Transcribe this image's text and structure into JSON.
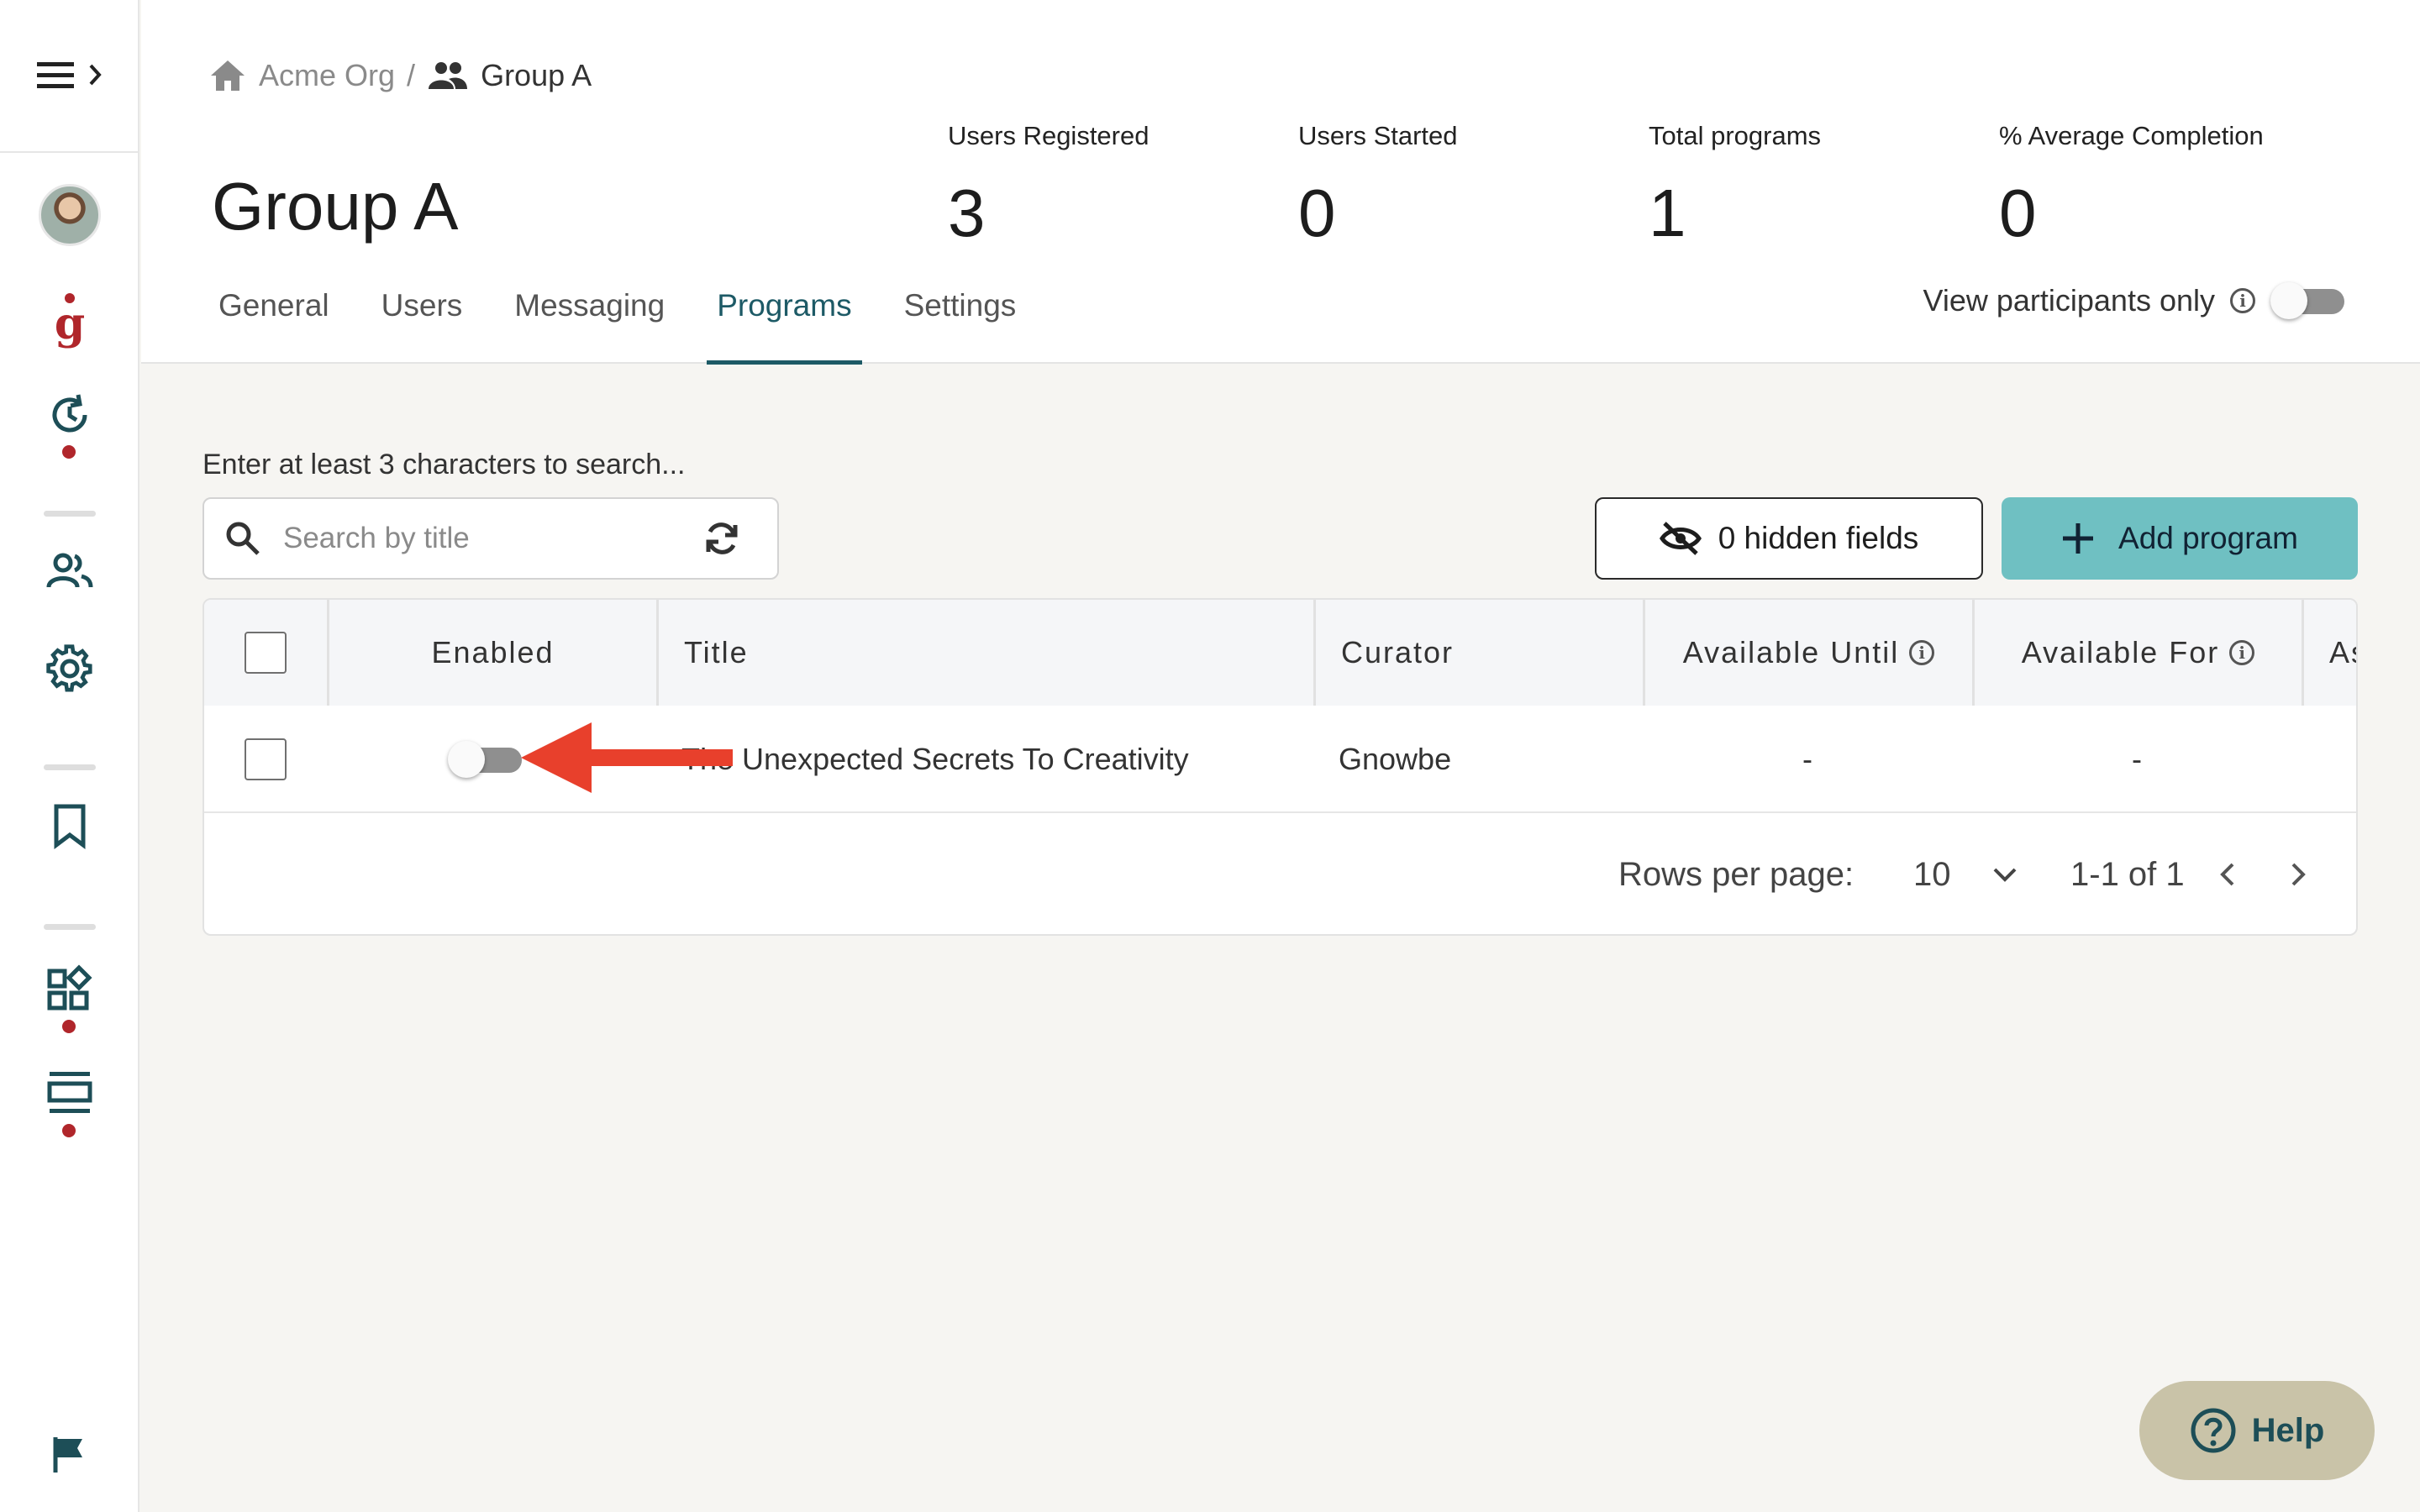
{
  "sidebar": {
    "icons": [
      "menu-expand-icon",
      "avatar",
      "brand-g-icon",
      "history-icon",
      "users-icon",
      "settings-icon",
      "bookmark-icon",
      "widgets-icon",
      "layout-icon",
      "flag-icon"
    ],
    "accent_color": "#b0262b",
    "icon_color": "#1d4e57"
  },
  "breadcrumb": {
    "org": "Acme Org",
    "separator": "/",
    "group": "Group A"
  },
  "page_title": "Group A",
  "stats": [
    {
      "label": "Users Registered",
      "value": "3"
    },
    {
      "label": "Users Started",
      "value": "0"
    },
    {
      "label": "Total programs",
      "value": "1"
    },
    {
      "label": "% Average Completion",
      "value": "0"
    }
  ],
  "tabs": [
    {
      "label": "General",
      "active": false
    },
    {
      "label": "Users",
      "active": false
    },
    {
      "label": "Messaging",
      "active": false
    },
    {
      "label": "Programs",
      "active": true
    },
    {
      "label": "Settings",
      "active": false
    }
  ],
  "view_participants": {
    "label": "View participants only",
    "enabled": false
  },
  "search": {
    "hint": "Enter at least 3 characters to search...",
    "placeholder": "Search by title",
    "value": ""
  },
  "toolbar": {
    "hidden_fields_label": "0 hidden fields",
    "add_program_label": "Add program",
    "add_color": "#6fc0c2"
  },
  "table": {
    "columns": [
      "Enabled",
      "Title",
      "Curator",
      "Available Until",
      "Available For",
      "As"
    ],
    "rows": [
      {
        "enabled": false,
        "title": "The Unexpected Secrets To Creativity",
        "curator": "Gnowbe",
        "available_until": "-",
        "available_for": "-"
      }
    ]
  },
  "pagination": {
    "rows_per_page_label": "Rows per page:",
    "rows_per_page": "10",
    "range": "1-1 of 1"
  },
  "annotation": {
    "type": "arrow",
    "color": "#e8402c"
  },
  "help": {
    "label": "Help"
  }
}
